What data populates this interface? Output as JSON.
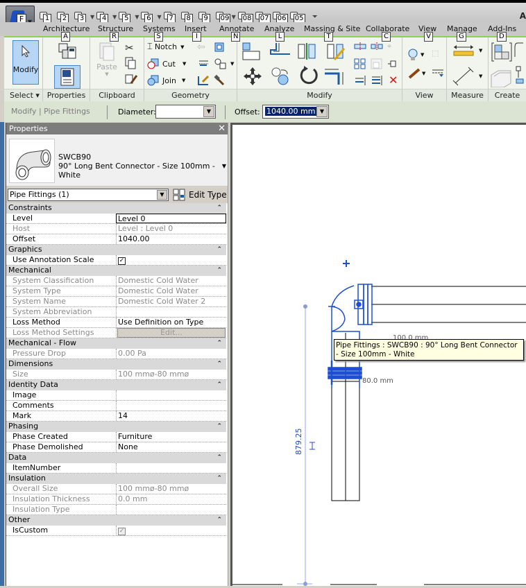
{
  "app": {
    "title_fragment": "A",
    "app_button_key": "F"
  },
  "quick_access": [
    {
      "icon": "open-icon",
      "key": "1"
    },
    {
      "icon": "save-icon",
      "key": "2"
    },
    {
      "icon": "sync-icon",
      "key": "3"
    },
    {
      "icon": "undo-icon",
      "key": "4"
    },
    {
      "icon": "redo-icon",
      "key": "5"
    },
    {
      "icon": "measure-icon",
      "key": "6"
    },
    {
      "icon": "aligned-dimension-icon",
      "key": "7"
    },
    {
      "icon": "tag-icon",
      "key": "8"
    },
    {
      "icon": "text-icon",
      "key": "9"
    },
    {
      "icon": "default-3d-view-icon",
      "key": "09"
    },
    {
      "icon": "section-icon",
      "key": "08"
    },
    {
      "icon": "thin-lines-icon",
      "key": "07"
    },
    {
      "icon": "close-hidden-windows-icon",
      "key": "06"
    },
    {
      "icon": "switch-windows-icon",
      "key": "05"
    }
  ],
  "tabs": [
    {
      "label": "Architecture",
      "key": "A"
    },
    {
      "label": "Structure",
      "key": "R"
    },
    {
      "label": "Systems",
      "key": "S"
    },
    {
      "label": "Insert",
      "key": "I"
    },
    {
      "label": "Annotate",
      "key": "N"
    },
    {
      "label": "Analyze",
      "key": "L"
    },
    {
      "label": "Massing & Site",
      "key": "T"
    },
    {
      "label": "Collaborate",
      "key": "C"
    },
    {
      "label": "View",
      "key": "V"
    },
    {
      "label": "Manage",
      "key": "G"
    },
    {
      "label": "Add-Ins",
      "key": "D"
    }
  ],
  "ribbon": {
    "panels": {
      "select": "Select",
      "properties": "Properties",
      "clipboard": "Clipboard",
      "geometry": "Geometry",
      "modify": "Modify",
      "view": "View",
      "measure": "Measure",
      "create": "Create"
    },
    "modify_label": "Modify",
    "paste_label": "Paste",
    "notch_label": "Notch",
    "cut_label": "Cut",
    "join_label": "Join"
  },
  "options_bar": {
    "context": "Modify | Pipe Fittings",
    "diameter_label": "Diameter:",
    "diameter_value": "",
    "offset_label": "Offset:",
    "offset_value": "1040.00 mm"
  },
  "properties": {
    "title": "Properties",
    "type_family": "SWCB90",
    "type_name": "90° Long Bent Connector - Size 100mm - White",
    "filter": "Pipe Fittings (1)",
    "edit_type": "Edit Type",
    "rows": [
      {
        "kind": "cat",
        "name": "Constraints"
      },
      {
        "kind": "prop",
        "name": "Level",
        "value": "Level 0",
        "selected": true
      },
      {
        "kind": "prop",
        "name": "Host",
        "value": "Level : Level 0",
        "readonly": true
      },
      {
        "kind": "prop",
        "name": "Offset",
        "value": "1040.00"
      },
      {
        "kind": "cat",
        "name": "Graphics"
      },
      {
        "kind": "check",
        "name": "Use Annotation Scale",
        "value": true
      },
      {
        "kind": "cat",
        "name": "Mechanical"
      },
      {
        "kind": "prop",
        "name": "System Classification",
        "value": "Domestic Cold Water",
        "readonly": true
      },
      {
        "kind": "prop",
        "name": "System Type",
        "value": "Domestic Cold Water",
        "readonly": true
      },
      {
        "kind": "prop",
        "name": "System Name",
        "value": "Domestic Cold Water 2",
        "readonly": true
      },
      {
        "kind": "prop",
        "name": "System Abbreviation",
        "value": "",
        "readonly": true
      },
      {
        "kind": "prop",
        "name": "Loss Method",
        "value": "Use Definition on Type"
      },
      {
        "kind": "button",
        "name": "Loss Method Settings",
        "value": "Edit...",
        "readonly": true
      },
      {
        "kind": "cat",
        "name": "Mechanical - Flow"
      },
      {
        "kind": "prop",
        "name": "Pressure Drop",
        "value": "0.00 Pa",
        "readonly": true
      },
      {
        "kind": "cat",
        "name": "Dimensions"
      },
      {
        "kind": "prop",
        "name": "Size",
        "value": "100 mmø-80 mmø",
        "readonly": true
      },
      {
        "kind": "cat",
        "name": "Identity Data"
      },
      {
        "kind": "prop",
        "name": "Image",
        "value": ""
      },
      {
        "kind": "prop",
        "name": "Comments",
        "value": ""
      },
      {
        "kind": "prop",
        "name": "Mark",
        "value": "14"
      },
      {
        "kind": "cat",
        "name": "Phasing"
      },
      {
        "kind": "prop",
        "name": "Phase Created",
        "value": "Furniture"
      },
      {
        "kind": "prop",
        "name": "Phase Demolished",
        "value": "None"
      },
      {
        "kind": "cat",
        "name": "Data"
      },
      {
        "kind": "prop",
        "name": "ItemNumber",
        "value": ""
      },
      {
        "kind": "cat",
        "name": "Insulation"
      },
      {
        "kind": "prop",
        "name": "Overall Size",
        "value": "100 mmø-80 mmø",
        "readonly": true
      },
      {
        "kind": "prop",
        "name": "Insulation Thickness",
        "value": "0.0 mm",
        "readonly": true
      },
      {
        "kind": "prop",
        "name": "Insulation Type",
        "value": "",
        "readonly": true
      },
      {
        "kind": "cat",
        "name": "Other"
      },
      {
        "kind": "checkdis",
        "name": "IsCustom",
        "value": true
      }
    ]
  },
  "canvas": {
    "tooltip": "Pipe Fittings : SWCB90 : 90° Long Bent Connector - Size 100mm - White",
    "dim_top": "100.0 mm",
    "dim_bottom": "80.0 mm",
    "vertical_dim": "879.25",
    "accent": "#1f4fd0"
  }
}
